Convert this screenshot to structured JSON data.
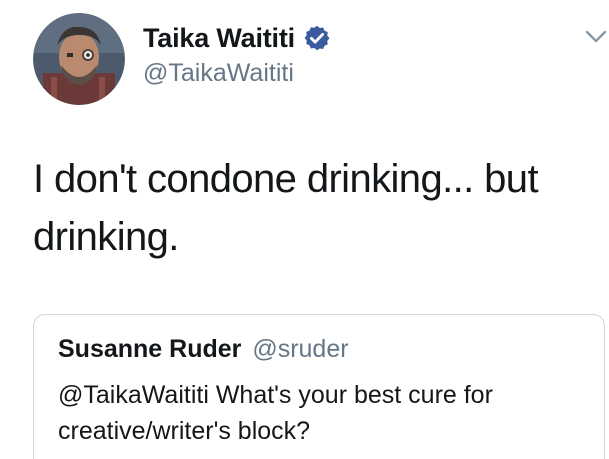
{
  "tweet": {
    "author": {
      "display_name": "Taika Waititi",
      "handle": "@TaikaWaititi",
      "verified": true,
      "avatar_icon": "avatar-photo"
    },
    "text": "I don't condone drinking... but drinking.",
    "menu_icon": "chevron-down-icon",
    "quoted": {
      "display_name": "Susanne Ruder",
      "handle": "@sruder",
      "text": "@TaikaWaititi What's your best cure for creative/writer's block?"
    }
  },
  "colors": {
    "verified_badge": "#3b5ba0",
    "secondary_text": "#657786",
    "primary_text": "#14171a",
    "quote_border": "#ccd6dd"
  }
}
